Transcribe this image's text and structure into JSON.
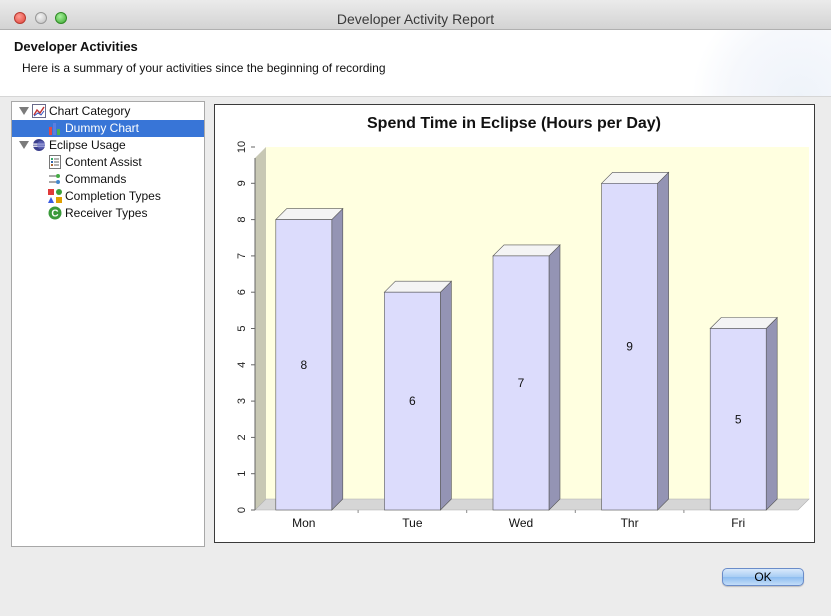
{
  "window": {
    "title": "Developer Activity Report"
  },
  "header": {
    "title": "Developer Activities",
    "subtitle": "Here is a summary of your activities since the beginning of recording"
  },
  "tree": {
    "items": [
      {
        "label": "Chart Category",
        "icon": "chart-category-icon",
        "expanded": true
      },
      {
        "label": "Dummy Chart",
        "icon": "bar-chart-icon",
        "selected": true
      },
      {
        "label": "Eclipse Usage",
        "icon": "eclipse-icon",
        "expanded": true
      },
      {
        "label": "Content Assist",
        "icon": "content-assist-icon"
      },
      {
        "label": "Commands",
        "icon": "commands-icon"
      },
      {
        "label": "Completion Types",
        "icon": "completion-types-icon"
      },
      {
        "label": "Receiver Types",
        "icon": "receiver-types-icon"
      }
    ]
  },
  "chart_data": {
    "type": "bar",
    "title": "Spend Time in Eclipse (Hours per Day)",
    "categories": [
      "Mon",
      "Tue",
      "Wed",
      "Thr",
      "Fri"
    ],
    "values": [
      8,
      6,
      7,
      9,
      5
    ],
    "ylim": [
      0,
      10
    ],
    "yticks": [
      "0",
      "1",
      "2",
      "3",
      "4",
      "5",
      "6",
      "7",
      "8",
      "9",
      "10"
    ],
    "grid": false,
    "bar_color": "#dcdcfc",
    "plot_background": "#ffffe0",
    "xlabel": "",
    "ylabel": ""
  },
  "buttons": {
    "ok": "OK"
  },
  "colors": {
    "selection": "#3875d7",
    "accent": "#8dbdf0"
  }
}
